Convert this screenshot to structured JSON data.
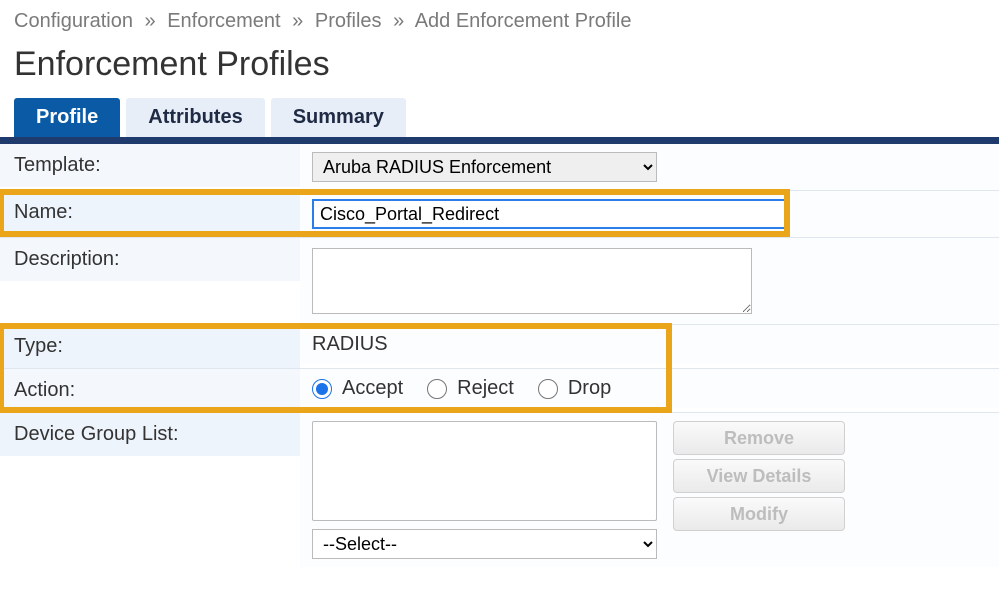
{
  "breadcrumb": {
    "b0": "Configuration",
    "b1": "Enforcement",
    "b2": "Profiles",
    "b3": "Add Enforcement Profile",
    "sep": "»"
  },
  "page_title": "Enforcement Profiles",
  "tabs": {
    "profile": "Profile",
    "attributes": "Attributes",
    "summary": "Summary"
  },
  "form": {
    "template_label": "Template:",
    "template_value": "Aruba RADIUS Enforcement",
    "name_label": "Name:",
    "name_value": "Cisco_Portal_Redirect",
    "description_label": "Description:",
    "description_value": "",
    "type_label": "Type:",
    "type_value": "RADIUS",
    "action_label": "Action:",
    "action_options": {
      "accept": "Accept",
      "reject": "Reject",
      "drop": "Drop"
    },
    "action_selected": "accept",
    "device_group_label": "Device Group List:",
    "device_group_select_placeholder": "--Select--"
  },
  "buttons": {
    "remove": "Remove",
    "view_details": "View Details",
    "modify": "Modify"
  }
}
